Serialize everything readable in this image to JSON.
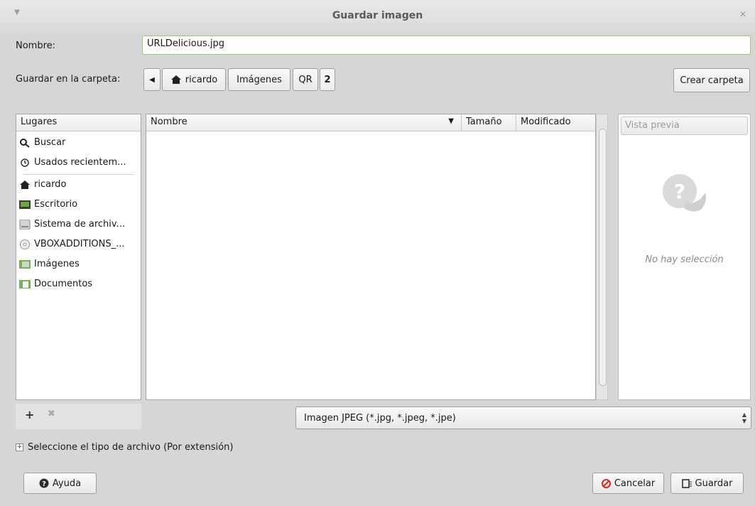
{
  "window": {
    "title": "Guardar imagen"
  },
  "name_row": {
    "label": "Nombre:",
    "value": "URLDelicious.jpg"
  },
  "folder_row": {
    "label": "Guardar en la carpeta:",
    "crumbs": [
      "ricardo",
      "Imágenes",
      "QR",
      "2"
    ],
    "create_folder": "Crear carpeta"
  },
  "places": {
    "header": "Lugares",
    "items": [
      {
        "label": "Buscar",
        "icon": "search-icon"
      },
      {
        "label": "Usados recientem...",
        "icon": "recent-icon"
      },
      {
        "label": "ricardo",
        "icon": "home-icon"
      },
      {
        "label": "Escritorio",
        "icon": "desktop-icon"
      },
      {
        "label": "Sistema de archiv...",
        "icon": "filesystem-icon"
      },
      {
        "label": "VBOXADDITIONS_...",
        "icon": "cdrom-icon"
      },
      {
        "label": "Imágenes",
        "icon": "pictures-folder-icon"
      },
      {
        "label": "Documentos",
        "icon": "documents-folder-icon"
      }
    ]
  },
  "files": {
    "columns": [
      "Nombre",
      "Tamaño",
      "Modificado"
    ],
    "rows": []
  },
  "preview": {
    "header": "Vista previa",
    "empty_text": "No hay selección"
  },
  "filter": {
    "selected": "Imagen JPEG (*.jpg, *.jpeg, *.jpe)"
  },
  "expander": {
    "label": "Seleccione el tipo de archivo (Por extensión)"
  },
  "buttons": {
    "help": "Ayuda",
    "cancel": "Cancelar",
    "save": "Guardar"
  },
  "colors": {
    "accent_border": "#a5bf8f",
    "window_bg": "#d6d6d6",
    "cancel_red": "#d52b1e"
  }
}
